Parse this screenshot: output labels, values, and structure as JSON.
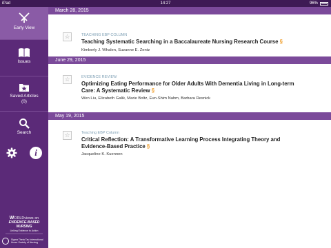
{
  "status_bar": {
    "device": "iPad",
    "time": "14:27",
    "battery": "96%"
  },
  "sidebar": {
    "items": [
      {
        "label": "Early View",
        "icon": "early-view-logo-icon",
        "active": true
      },
      {
        "label": "Issues",
        "icon": "book-icon",
        "active": false
      },
      {
        "label": "Saved Articles",
        "count": "(0)",
        "icon": "star-folder-icon",
        "active": false
      },
      {
        "label": "Search",
        "icon": "search-icon",
        "active": false
      }
    ],
    "utilities": [
      {
        "icon": "gear-icon"
      },
      {
        "icon": "info-icon",
        "glyph": "i"
      }
    ],
    "logo_main": {
      "prefix": "W",
      "rest": "ORLDviews",
      "on": "on",
      "line2": "EVIDENCE-BASED NURSING",
      "tagline": "Linking Evidence to Action"
    },
    "logo_society": {
      "line1": "Sigma Theta Tau International",
      "line2": "Honor Society of Nursing"
    }
  },
  "sections": [
    {
      "date": "March 28, 2015",
      "articles": [
        {
          "category": "TEACHING EBP COLUMN",
          "title": "Teaching Systematic Searching in a Baccalaureate Nursing Research Course",
          "authors": "Kimberly J. Whalen, Suzanne E. Zentz"
        }
      ]
    },
    {
      "date": "June 29, 2015",
      "articles": [
        {
          "category": "EVIDENCE REVIEW",
          "title": "Optimizing Eating Performance for Older Adults With Dementia Living in Long-term Care: A Systematic Review",
          "authors": "Wen Liu, Elizabeth Galik, Marie Boltz, Eun-Shim Nahm, Barbara Resnick"
        }
      ]
    },
    {
      "date": "May 19, 2015",
      "articles": [
        {
          "category": "Teaching EBP Column",
          "title": "Critical Reflection: A Transformative Learning Process Integrating Theory and Evidence-Based Practice",
          "authors": "Jacqueline K. Kuennen"
        }
      ]
    }
  ],
  "open_access_glyph": "§",
  "colors": {
    "sidebar": "#5b2a78",
    "sidebar_active": "#8a5ba6",
    "date_bar": "#7b4a9a",
    "category": "#7fa0b5",
    "open_access": "#f0a030"
  }
}
